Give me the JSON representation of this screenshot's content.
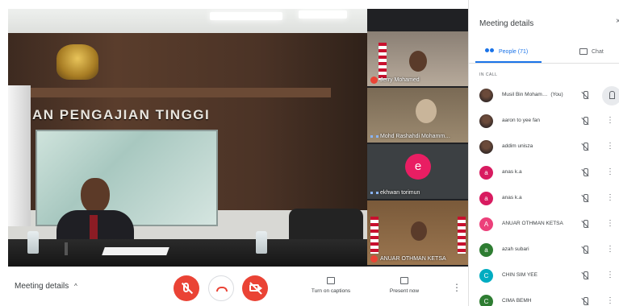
{
  "main_video": {
    "sign_text": "RIAN PENGAJIAN TINGGI"
  },
  "tiles": [
    {
      "name": "Jerry Mohamed",
      "muted": true
    },
    {
      "name": "Mohd Rashahdi Mohamm…",
      "muted": false
    },
    {
      "name": "ekhwan torimun",
      "muted": false,
      "avatar_letter": "e",
      "avatar_color": "#e91e63"
    },
    {
      "name": "ANUAR OTHMAN KETSA",
      "muted": true
    }
  ],
  "panel": {
    "title": "Meeting details",
    "close": "×",
    "tabs": {
      "people": "People (71)",
      "chat": "Chat"
    },
    "section_label": "IN CALL",
    "people": [
      {
        "name": "Musil Bin Moham…",
        "tag": "(You)",
        "avatar_letter": "",
        "avatar_color": "#1a237e",
        "photo": true
      },
      {
        "name": "aaron to yee fan",
        "tag": "",
        "avatar_letter": "",
        "avatar_color": "#3a2d2a",
        "photo": true
      },
      {
        "name": "addim unisza",
        "tag": "",
        "avatar_letter": "",
        "avatar_color": "#2d2d2d",
        "photo": true
      },
      {
        "name": "anas k.a",
        "tag": "",
        "avatar_letter": "a",
        "avatar_color": "#d81b60",
        "photo": false
      },
      {
        "name": "anas k.a",
        "tag": "",
        "avatar_letter": "a",
        "avatar_color": "#d81b60",
        "photo": false
      },
      {
        "name": "ANUAR OTHMAN KETSA",
        "tag": "",
        "avatar_letter": "A",
        "avatar_color": "#ec407a",
        "photo": false
      },
      {
        "name": "azah subari",
        "tag": "",
        "avatar_letter": "a",
        "avatar_color": "#2e7d32",
        "photo": false
      },
      {
        "name": "CHIN SIM YEE",
        "tag": "",
        "avatar_letter": "C",
        "avatar_color": "#00acc1",
        "photo": false
      },
      {
        "name": "CIMA BEMH",
        "tag": "",
        "avatar_letter": "C",
        "avatar_color": "#2e7d32",
        "photo": false
      }
    ]
  },
  "bottombar": {
    "meeting_details": "Meeting details",
    "chevron": "^",
    "captions_label": "Turn on captions",
    "present_label": "Present now",
    "more": "⋮"
  },
  "colors": {
    "accent": "#1a73e8",
    "danger": "#ea4335"
  }
}
